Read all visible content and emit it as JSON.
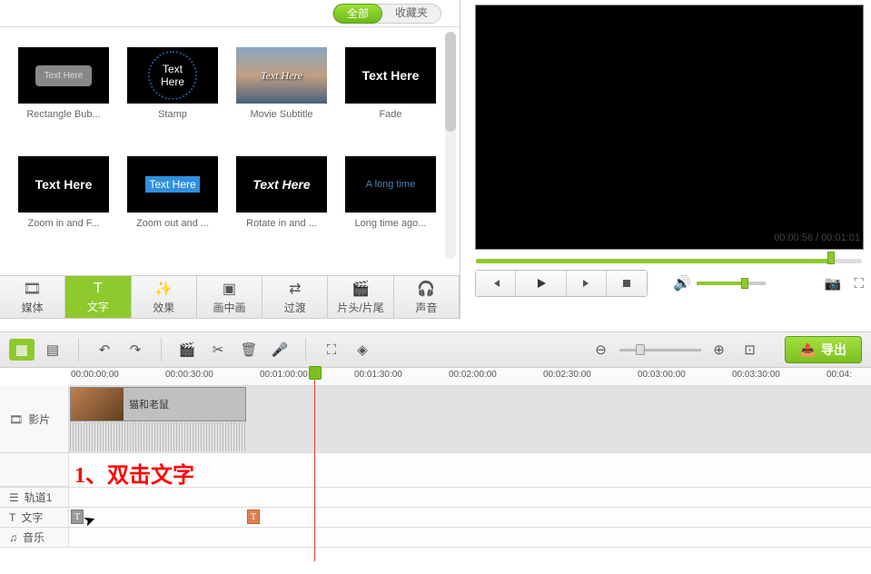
{
  "header": {
    "tab_all": "全部",
    "tab_favorites": "收藏夹"
  },
  "library": {
    "items": [
      {
        "label": "Rectangle Bub...",
        "text": "Text Here",
        "style": "rect-bub"
      },
      {
        "label": "Stamp",
        "text": "Text Here",
        "style": "stamp"
      },
      {
        "label": "Movie Subtitle",
        "text": "Text Here",
        "style": "movie"
      },
      {
        "label": "Fade",
        "text": "Text Here",
        "style": "fade"
      },
      {
        "label": "Zoom in and F...",
        "text": "Text Here",
        "style": "zoomin"
      },
      {
        "label": "Zoom out and ...",
        "text": "Text Here",
        "style": "zoomout"
      },
      {
        "label": "Rotate in and ...",
        "text": "Text Here",
        "style": "rotate"
      },
      {
        "label": "Long time ago...",
        "text": "A long time",
        "style": "long"
      }
    ]
  },
  "categories": {
    "media": "媒体",
    "text": "文字",
    "effects": "效果",
    "pip": "画中画",
    "transition": "过渡",
    "intro": "片头/片尾",
    "audio": "声音"
  },
  "preview": {
    "time": "00:00:56 / 00:01:01"
  },
  "toolbar": {
    "export": "导出"
  },
  "timeline": {
    "marks": [
      "00:00:00:00",
      "00:00:30:00",
      "00:01:00:00",
      "00:01:30:00",
      "00:02:00:00",
      "00:02:30:00",
      "00:03:00:00",
      "00:03:30:00",
      "00:04:"
    ],
    "tracks": {
      "video": "影片",
      "track1": "轨道1",
      "text": "文字",
      "music": "音乐"
    },
    "clip_name": "猫和老鼠"
  },
  "annotation": {
    "text": "1、双击文字"
  }
}
